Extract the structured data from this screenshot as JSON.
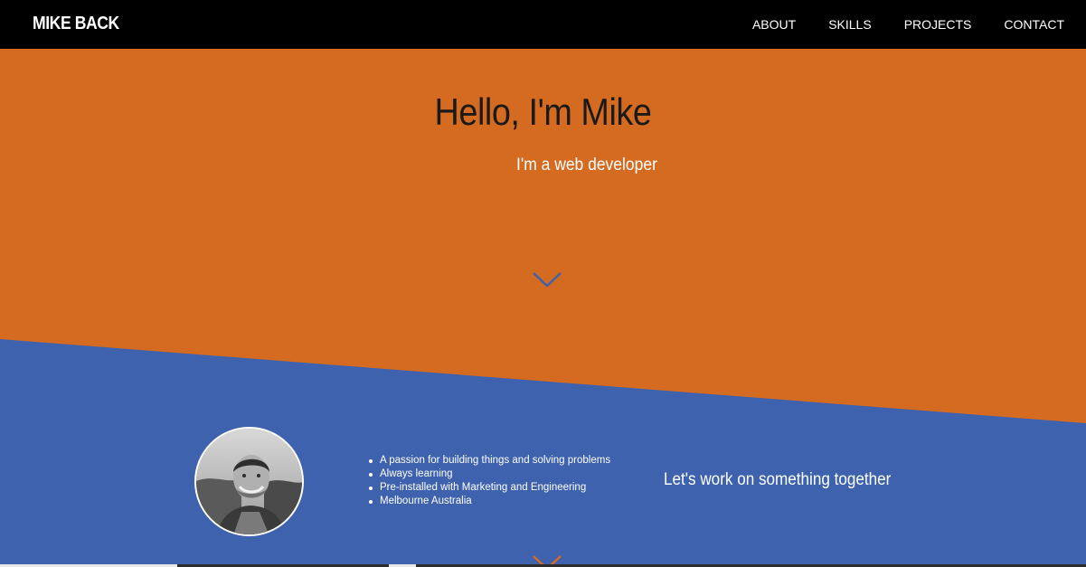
{
  "nav": {
    "brand": "MIKE BACK",
    "links": [
      "ABOUT",
      "SKILLS",
      "PROJECTS",
      "CONTACT"
    ]
  },
  "hero": {
    "title": "Hello, I'm Mike",
    "subtitle": "I'm a web developer",
    "scroll_icon": "chevron-down-icon"
  },
  "about": {
    "features": [
      "A passion for building things and solving problems",
      "Always learning",
      "Pre-installed with Marketing and Engineering",
      "Melbourne Australia"
    ],
    "cta": "Let's work on something together",
    "scroll_icon": "chevron-down-icon"
  },
  "colors": {
    "navbar": "#000000",
    "hero_bg": "#d46b20",
    "about_bg": "#3e62ad",
    "hero_chevron": "#3e62ad",
    "about_chevron": "#d46b20",
    "heading_text": "#1a1a1a",
    "light_text": "#ffffff"
  }
}
